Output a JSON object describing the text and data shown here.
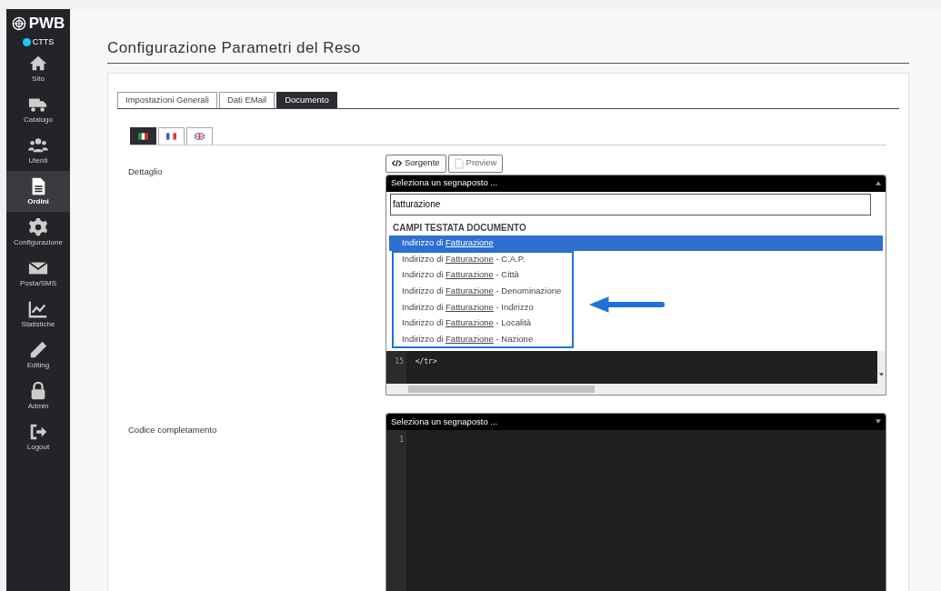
{
  "sidebar": {
    "logo": "PWB",
    "status": {
      "label": "CTTS",
      "color": "#1ec8f5"
    },
    "items": [
      {
        "label": "Sito",
        "selected": false
      },
      {
        "label": "Catalogo",
        "selected": false
      },
      {
        "label": "Utenti",
        "selected": false
      },
      {
        "label": "Ordini",
        "selected": true
      },
      {
        "label": "Configurazione",
        "selected": false
      },
      {
        "label": "Posta/SMS",
        "selected": false
      },
      {
        "label": "Statistiche",
        "selected": false
      },
      {
        "label": "Editing",
        "selected": false
      },
      {
        "label": "Admin",
        "selected": false
      },
      {
        "label": "Logout",
        "selected": false
      }
    ]
  },
  "page_title": "Configurazione Parametri del Reso",
  "tabs": [
    {
      "label": "Impostazioni Generali",
      "selected": false
    },
    {
      "label": "Dati EMail",
      "selected": false
    },
    {
      "label": "Documento",
      "selected": true
    }
  ],
  "language_tabs": [
    {
      "kind": "it",
      "selected": true
    },
    {
      "kind": "fr",
      "selected": false
    },
    {
      "kind": "gb",
      "selected": false
    }
  ],
  "fields": [
    {
      "label": "Dettaglio",
      "buttons": [
        {
          "label": "Sorgente",
          "kind": "code"
        },
        {
          "label": "Preview",
          "kind": "page"
        }
      ],
      "placeholder_select": {
        "label": "Seleziona un segnaposto ...",
        "expanded": true,
        "search_value": "fatturazione",
        "group": "CAMPI TESTATA DOCUMENTO",
        "options": [
          {
            "before": "Indirizzo di ",
            "match": "Fatturazione",
            "selected": true
          },
          {
            "before": "Indirizzo di ",
            "match": "Fatturazione",
            "after": " - C.A.P.",
            "selected": false
          },
          {
            "before": "Indirizzo di ",
            "match": "Fatturazione",
            "after": " - Città",
            "selected": false
          },
          {
            "before": "Indirizzo di ",
            "match": "Fatturazione",
            "after": " - Denominazione",
            "selected": false
          },
          {
            "before": "Indirizzo di ",
            "match": "Fatturazione",
            "after": " - Indirizzo",
            "selected": false
          },
          {
            "before": "Indirizzo di ",
            "match": "Fatturazione",
            "after": " - Località",
            "selected": false
          },
          {
            "before": "Indirizzo di ",
            "match": "Fatturazione",
            "after": " - Nazione",
            "selected": false
          }
        ]
      },
      "code_lines": [
        {
          "number": "15",
          "text": "  </tr>"
        }
      ]
    },
    {
      "label": "Codice completamento",
      "placeholder_select": {
        "label": "Seleziona un segnaposto ...",
        "expanded": false
      },
      "code_lines": [
        {
          "number": "1"
        }
      ]
    }
  ]
}
